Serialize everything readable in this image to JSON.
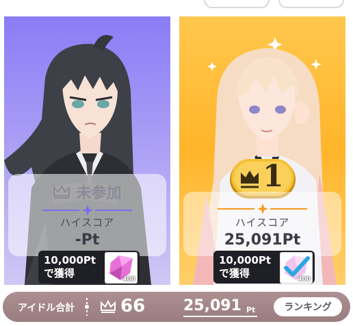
{
  "cards": [
    {
      "status_label": "未参加",
      "highscore_label": "ハイスコア",
      "highscore_value": "-Pt",
      "reward_line1": "10,000Pt",
      "reward_line2": "で獲得",
      "reward_count": "400",
      "accent_color": "#7b6cf0",
      "claimed": false
    },
    {
      "rank": "1",
      "highscore_label": "ハイスコア",
      "highscore_value": "25,091Pt",
      "reward_line1": "10,000Pt",
      "reward_line2": "で獲得",
      "reward_count": "400",
      "accent_color": "#f39a1c",
      "claimed": true
    }
  ],
  "bottom_bar": {
    "label": "アイドル合計",
    "crown_count": "66",
    "total_score": "25,091",
    "score_unit": "Pt",
    "ranking_button": "ランキング"
  }
}
